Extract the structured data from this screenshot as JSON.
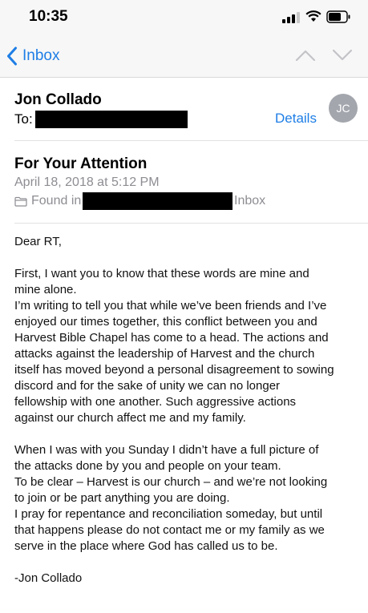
{
  "status_bar": {
    "time": "10:35"
  },
  "nav": {
    "back_label": "Inbox"
  },
  "header": {
    "sender": "Jon Collado",
    "to_label": "To:",
    "details_label": "Details",
    "avatar_initials": "JC"
  },
  "message": {
    "subject": "For Your Attention",
    "date": "April 18, 2018 at 5:12 PM",
    "found_prefix": "Found in",
    "found_mailbox": "Inbox",
    "greeting": "Dear RT,",
    "lines1": [
      "First, I want you to know that these words are mine and",
      "mine alone.",
      "I’m writing to tell you that while we’ve been friends and I’ve",
      "enjoyed our times together, this conflict between you and",
      "Harvest Bible Chapel has come to a head. The actions and",
      "attacks against the leadership of Harvest and the church",
      "itself has moved beyond a personal disagreement to sowing",
      "discord and for the sake of unity we can no longer",
      "fellowship with one another. Such aggressive actions",
      "against our church affect me and my family."
    ],
    "lines2": [
      "When I was with you Sunday I didn’t have a full picture of",
      "the attacks done by you and people on your team.",
      "To be clear – Harvest is our church – and we’re not looking",
      "to join or be part anything you are doing.",
      "I pray for repentance and reconciliation someday, but until",
      "that happens please do not contact me or my family as we",
      "serve in the place where God has called us to be."
    ],
    "signature": "-Jon Collado"
  },
  "colors": {
    "accent": "#1e7ee6",
    "secondary_text": "#8d8d93",
    "avatar_bg": "#a3a6ad"
  },
  "icons": [
    "cellular-signal-icon",
    "wifi-icon",
    "battery-icon",
    "chevron-left-icon",
    "chevron-up-icon",
    "chevron-down-icon",
    "folder-icon"
  ]
}
